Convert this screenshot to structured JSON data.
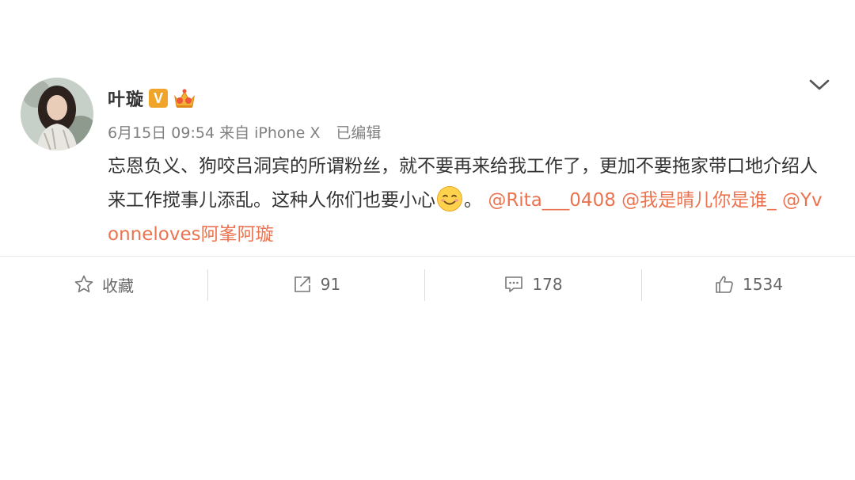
{
  "post": {
    "user": {
      "name": "叶璇",
      "verified_badge": "V",
      "crown_icon": "crown-icon"
    },
    "meta": {
      "timestamp": "6月15日 09:54",
      "source": "来自 iPhone X",
      "edited": "已编辑"
    },
    "content": {
      "text": "忘恩负义、狗咬吕洞宾的所谓粉丝，就不要再来给我工作了，更加不要拖家带口地介绍人来工作搅事儿添乱。这种人你们也要小心",
      "emoji": "smile-emoji",
      "after_emoji": "。",
      "mentions": [
        "@Rita___0408",
        "@我是晴儿你是谁_",
        "@Yvonneloves阿峯阿璇"
      ]
    },
    "actions": {
      "favorite_label": "收藏",
      "repost_count": "91",
      "comment_count": "178",
      "like_count": "1534"
    }
  },
  "colors": {
    "mention": "#eb7350",
    "badge": "#f0a52a",
    "text": "#333333",
    "meta": "#808080"
  }
}
